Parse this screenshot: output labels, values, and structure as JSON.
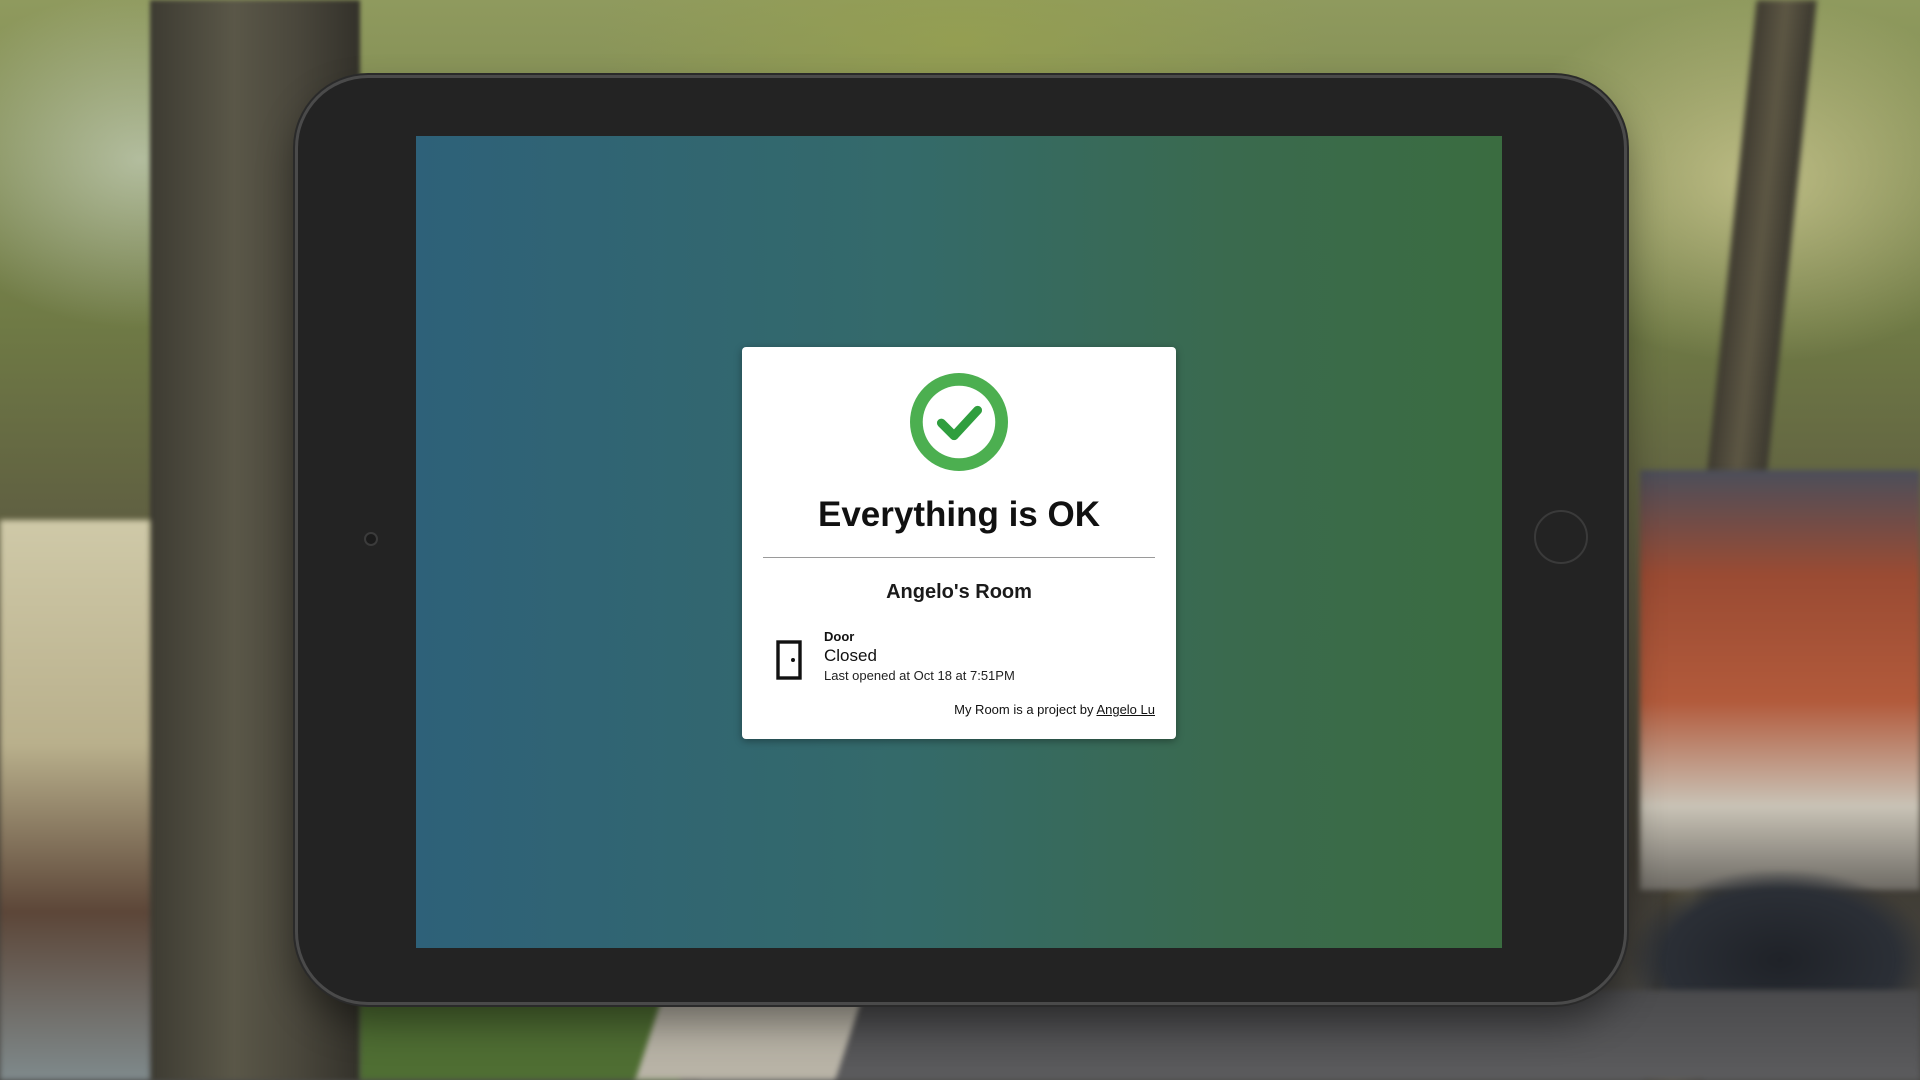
{
  "status": {
    "icon": "check-circle-icon",
    "color": "#4CAF50",
    "title": "Everything is OK"
  },
  "room": {
    "name": "Angelo's Room"
  },
  "sensor": {
    "icon": "door-icon",
    "label": "Door",
    "state": "Closed",
    "last_opened": "Last opened at Oct 18 at 7:51PM"
  },
  "footer": {
    "credit_text": "My Room is a project by ",
    "author_link": "Angelo Lu"
  },
  "colors": {
    "screen_gradient_start": "#2e6179",
    "screen_gradient_end": "#3a6c40",
    "tablet_bezel": "#232323"
  }
}
